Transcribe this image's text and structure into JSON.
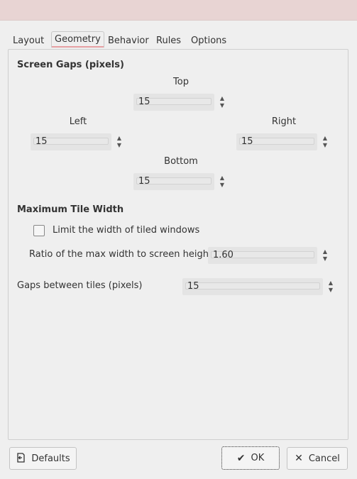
{
  "tabs": [
    {
      "label": "Layout"
    },
    {
      "label": "Geometry"
    },
    {
      "label": "Behavior"
    },
    {
      "label": "Rules"
    },
    {
      "label": "Options"
    }
  ],
  "active_tab": "Geometry",
  "screen_gaps": {
    "title": "Screen Gaps (pixels)",
    "top_label": "Top",
    "top_value": "15",
    "left_label": "Left",
    "left_value": "15",
    "right_label": "Right",
    "right_value": "15",
    "bottom_label": "Bottom",
    "bottom_value": "15"
  },
  "max_tile_width": {
    "title": "Maximum Tile Width",
    "limit_label": "Limit the width of tiled windows",
    "limit_checked": false,
    "ratio_label": "Ratio of the max width to screen height",
    "ratio_value": "1.60"
  },
  "gaps_between": {
    "label": "Gaps between tiles (pixels)",
    "value": "15"
  },
  "buttons": {
    "defaults": "Defaults",
    "ok": "OK",
    "cancel": "Cancel"
  },
  "icons": {
    "defaults": "reset-document-icon",
    "ok": "checkmark-icon",
    "cancel": "x-icon",
    "spin_up": "arrow-up-icon",
    "spin_down": "arrow-down-icon"
  }
}
